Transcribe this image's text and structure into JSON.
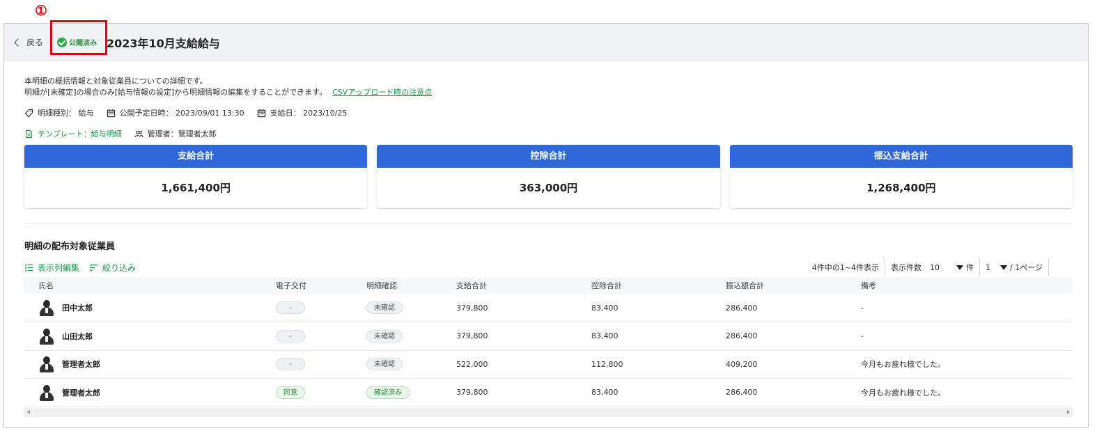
{
  "annotation": {
    "number": "①"
  },
  "header": {
    "back_label": "戻る",
    "status_badge": "公開済み",
    "title": "2023年10月支給給与"
  },
  "description": {
    "line1": "本明細の概括情報と対象従業員についての詳細です。",
    "line2": "明細が[未確定]の場合のみ[給与情報の設定]から明細情報の編集をすることができます。",
    "csv_link": "CSVアップロード時の注意点"
  },
  "meta": {
    "type": "明細種別： 給与",
    "publish_date": "公開予定日時： 2023/09/01 13:30",
    "pay_date": "支給日： 2023/10/25",
    "template": "テンプレート：給与明細",
    "manager": "管理者：管理者太郎"
  },
  "summary_cards": [
    {
      "title": "支給合計",
      "value": "1,661,400円"
    },
    {
      "title": "控除合計",
      "value": "363,000円"
    },
    {
      "title": "振込支給合計",
      "value": "1,268,400円"
    }
  ],
  "employees_section": {
    "title": "明細の配布対象従業員",
    "edit_columns": "表示列編集",
    "filter": "絞り込み",
    "count_text": "4件中の1~4件表示",
    "per_page_label": "表示件数",
    "per_page_value": "10",
    "per_page_unit": "件",
    "page_value": "1",
    "page_suffix": "/ 1ページ"
  },
  "table": {
    "headers": [
      "氏名",
      "電子交付",
      "明細確認",
      "支給合計",
      "控除合計",
      "振込額合計",
      "備考"
    ],
    "rows": [
      {
        "name": "田中太郎",
        "e_delivery": "-",
        "confirm": "未確認",
        "pay": "379,800",
        "deduct": "83,400",
        "transfer": "286,400",
        "note": "-"
      },
      {
        "name": "山田太郎",
        "e_delivery": "-",
        "confirm": "未確認",
        "pay": "379,800",
        "deduct": "83,400",
        "transfer": "286,400",
        "note": "-"
      },
      {
        "name": "管理者太郎",
        "e_delivery": "-",
        "confirm": "未確認",
        "pay": "522,000",
        "deduct": "112,800",
        "transfer": "409,200",
        "note": "今月もお疲れ様でした。"
      },
      {
        "name": "管理者太郎",
        "e_delivery": "同意",
        "confirm": "確認済み",
        "pay": "379,800",
        "deduct": "83,400",
        "transfer": "286,400",
        "note": "今月もお疲れ様でした。"
      }
    ]
  },
  "colors": {
    "accent_blue": "#2f67d8",
    "accent_green": "#1e9a4c",
    "annotation_red": "#e60012"
  },
  "icons": [
    "chevron-left-icon",
    "check-circle-icon",
    "tag-icon",
    "calendar-icon",
    "document-icon",
    "users-icon",
    "list-edit-icon",
    "filter-icon",
    "caret-down-icon",
    "avatar-icon"
  ]
}
